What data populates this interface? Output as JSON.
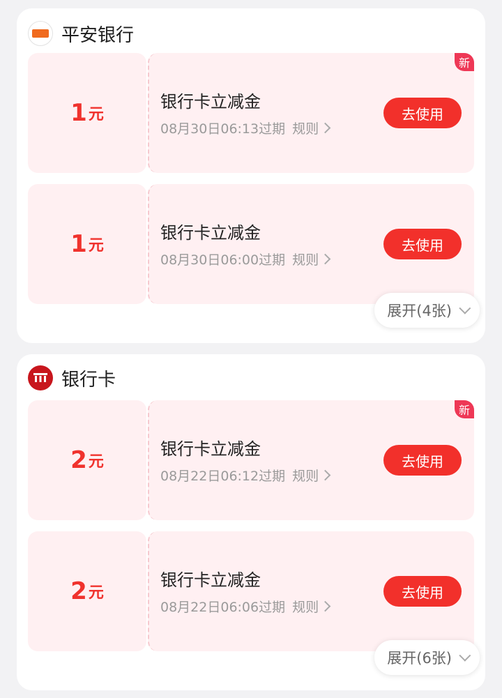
{
  "groups": [
    {
      "bank_name": "平安银行",
      "logo": "pingan-bank-icon",
      "expand_label": "展开(4张)",
      "coupons": [
        {
          "amount": "1",
          "unit": "元",
          "title": "银行卡立减金",
          "expiry": "08月30日06:13过期",
          "rule": "规则",
          "button": "去使用",
          "badge": "新"
        },
        {
          "amount": "1",
          "unit": "元",
          "title": "银行卡立减金",
          "expiry": "08月30日06:00过期",
          "rule": "规则",
          "button": "去使用"
        }
      ]
    },
    {
      "bank_name": "银行卡",
      "logo": "bank-card-icon",
      "expand_label": "展开(6张)",
      "coupons": [
        {
          "amount": "2",
          "unit": "元",
          "title": "银行卡立减金",
          "expiry": "08月22日06:12过期",
          "rule": "规则",
          "button": "去使用",
          "badge": "新"
        },
        {
          "amount": "2",
          "unit": "元",
          "title": "银行卡立减金",
          "expiry": "08月22日06:06过期",
          "rule": "规则",
          "button": "去使用"
        }
      ]
    }
  ],
  "colors": {
    "accent": "#f2302b",
    "coupon_bg": "#fff0f2",
    "badge": "#ee3856"
  }
}
